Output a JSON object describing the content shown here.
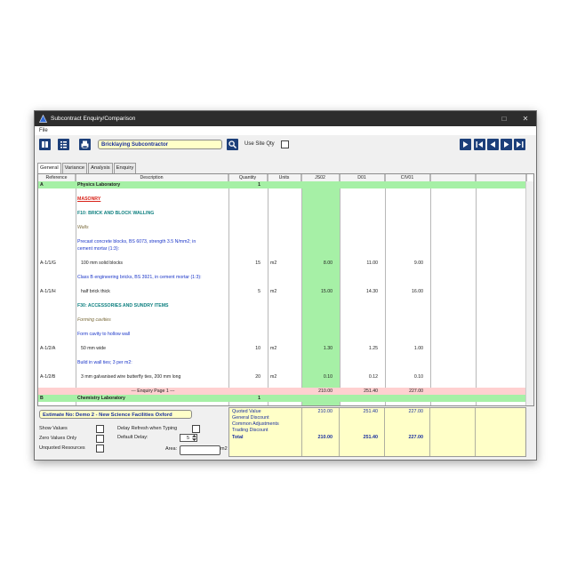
{
  "window": {
    "title": "Subcontract Enquiry/Comparison",
    "min": "□",
    "close": "✕"
  },
  "menu": {
    "file": "File"
  },
  "toolbar": {
    "subcontractor": "Bricklaying Subcontractor",
    "use_site_qty": "Use Site Qty"
  },
  "tabs": [
    "General",
    "Variance",
    "Analysis",
    "Enquiry"
  ],
  "columns": [
    "Reference",
    "Description",
    "Quantity",
    "Units",
    "JS02",
    "D01",
    "CIV01",
    "",
    ""
  ],
  "rows": [
    {
      "ref": "A",
      "desc": "Physics Laboratory",
      "qty": "1",
      "units": "",
      "v1": "",
      "v2": "",
      "v3": "",
      "style": "section"
    },
    {
      "ref": "",
      "desc": "",
      "qty": "",
      "units": "",
      "v1": "",
      "v2": "",
      "v3": "",
      "style": "blank"
    },
    {
      "ref": "",
      "desc": "MASONRY",
      "qty": "",
      "units": "",
      "v1": "",
      "v2": "",
      "v3": "",
      "style": "heading-red"
    },
    {
      "ref": "",
      "desc": "",
      "qty": "",
      "units": "",
      "v1": "",
      "v2": "",
      "v3": "",
      "style": "blank"
    },
    {
      "ref": "",
      "desc": "F10: BRICK AND BLOCK WALLING",
      "qty": "",
      "units": "",
      "v1": "",
      "v2": "",
      "v3": "",
      "style": "heading-teal"
    },
    {
      "ref": "",
      "desc": "",
      "qty": "",
      "units": "",
      "v1": "",
      "v2": "",
      "v3": "",
      "style": "blank"
    },
    {
      "ref": "",
      "desc": "Walls",
      "qty": "",
      "units": "",
      "v1": "",
      "v2": "",
      "v3": "",
      "style": "italic"
    },
    {
      "ref": "",
      "desc": "",
      "qty": "",
      "units": "",
      "v1": "",
      "v2": "",
      "v3": "",
      "style": "blank"
    },
    {
      "ref": "",
      "desc": "Precast concrete blocks, BS 6073, strength 3.5 N/mm2; in",
      "qty": "",
      "units": "",
      "v1": "",
      "v2": "",
      "v3": "",
      "style": "blue"
    },
    {
      "ref": "",
      "desc": "cement mortar (1:3):",
      "qty": "",
      "units": "",
      "v1": "",
      "v2": "",
      "v3": "",
      "style": "blue"
    },
    {
      "ref": "",
      "desc": "",
      "qty": "",
      "units": "",
      "v1": "",
      "v2": "",
      "v3": "",
      "style": "blank"
    },
    {
      "ref": "A-1/1/G",
      "desc": "100 mm solid blocks",
      "qty": "15",
      "units": "m2",
      "v1": "8.00",
      "v2": "11.00",
      "v3": "9.00",
      "style": "item"
    },
    {
      "ref": "",
      "desc": "",
      "qty": "",
      "units": "",
      "v1": "",
      "v2": "",
      "v3": "",
      "style": "blank"
    },
    {
      "ref": "",
      "desc": "Class B engineering bricks, BS 3921, in cement mortar (1:3):",
      "qty": "",
      "units": "",
      "v1": "",
      "v2": "",
      "v3": "",
      "style": "blue"
    },
    {
      "ref": "",
      "desc": "",
      "qty": "",
      "units": "",
      "v1": "",
      "v2": "",
      "v3": "",
      "style": "blank"
    },
    {
      "ref": "A-1/1/H",
      "desc": "half brick thick",
      "qty": "5",
      "units": "m2",
      "v1": "15.00",
      "v2": "14.30",
      "v3": "16.00",
      "style": "item"
    },
    {
      "ref": "",
      "desc": "",
      "qty": "",
      "units": "",
      "v1": "",
      "v2": "",
      "v3": "",
      "style": "blank"
    },
    {
      "ref": "",
      "desc": "F30: ACCESSORIES AND SUNDRY ITEMS",
      "qty": "",
      "units": "",
      "v1": "",
      "v2": "",
      "v3": "",
      "style": "heading-teal"
    },
    {
      "ref": "",
      "desc": "",
      "qty": "",
      "units": "",
      "v1": "",
      "v2": "",
      "v3": "",
      "style": "blank"
    },
    {
      "ref": "",
      "desc": "Forming cavities",
      "qty": "",
      "units": "",
      "v1": "",
      "v2": "",
      "v3": "",
      "style": "italic"
    },
    {
      "ref": "",
      "desc": "",
      "qty": "",
      "units": "",
      "v1": "",
      "v2": "",
      "v3": "",
      "style": "blank"
    },
    {
      "ref": "",
      "desc": "Form cavity to hollow wall",
      "qty": "",
      "units": "",
      "v1": "",
      "v2": "",
      "v3": "",
      "style": "blue"
    },
    {
      "ref": "",
      "desc": "",
      "qty": "",
      "units": "",
      "v1": "",
      "v2": "",
      "v3": "",
      "style": "blank"
    },
    {
      "ref": "A-1/2/A",
      "desc": "50 mm wide",
      "qty": "10",
      "units": "m2",
      "v1": "1.30",
      "v2": "1.25",
      "v3": "1.00",
      "style": "item"
    },
    {
      "ref": "",
      "desc": "",
      "qty": "",
      "units": "",
      "v1": "",
      "v2": "",
      "v3": "",
      "style": "blank"
    },
    {
      "ref": "",
      "desc": "Build in wall ties; 3 per m2:",
      "qty": "",
      "units": "",
      "v1": "",
      "v2": "",
      "v3": "",
      "style": "blue"
    },
    {
      "ref": "",
      "desc": "",
      "qty": "",
      "units": "",
      "v1": "",
      "v2": "",
      "v3": "",
      "style": "blank"
    },
    {
      "ref": "A-1/2/B",
      "desc": "3 mm galvanised wire butterfly ties, 200 mm long",
      "qty": "20",
      "units": "m2",
      "v1": "0.10",
      "v2": "0.12",
      "v3": "0.10",
      "style": "item"
    },
    {
      "ref": "",
      "desc": "",
      "qty": "",
      "units": "",
      "v1": "",
      "v2": "",
      "v3": "",
      "style": "blank"
    },
    {
      "ref": "",
      "desc": "--- Enquiry Page 1 ---",
      "qty": "",
      "units": "",
      "v1": "210.00",
      "v2": "251.40",
      "v3": "227.00",
      "style": "page"
    },
    {
      "ref": "B",
      "desc": "Chemistry Laboratory",
      "qty": "1",
      "units": "",
      "v1": "",
      "v2": "",
      "v3": "",
      "style": "section"
    }
  ],
  "estimate": "Estimate No: Demo 2 - New Science Facilities Oxford",
  "options": {
    "show_values": "Show Values",
    "zero_values_only": "Zero Values Only",
    "unquoted_resources": "Unquoted Resources",
    "delay_refresh": "Delay Refresh when Typing",
    "default_delay": "Default Delay:",
    "default_delay_value": "5",
    "area": "Area:",
    "area_unit": "m2"
  },
  "summary": {
    "labels": [
      "Quoted Value",
      "General Discount",
      "Common Adjustments",
      "Trading Discount",
      "Total"
    ],
    "quoted": [
      "210.00",
      "251.40",
      "227.00"
    ],
    "total": [
      "210.00",
      "251.40",
      "227.00"
    ]
  },
  "colors": {
    "section": "#a6f0a6",
    "page": "#ffd0d0",
    "col_js02": "#a6f0a6",
    "heading_red": "#d9231a",
    "heading_teal": "#0f8080",
    "text_blue": "#1a35c8",
    "field_yellow": "#ffffc8"
  }
}
